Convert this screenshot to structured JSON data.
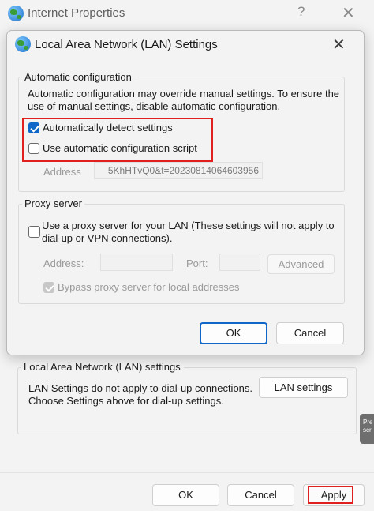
{
  "parent_window": {
    "title": "Internet Properties",
    "help_glyph": "?",
    "close_glyph": "✕",
    "lan_section": {
      "title": "Local Area Network (LAN) settings",
      "description": "LAN Settings do not apply to dial-up connections. Choose Settings above for dial-up settings.",
      "lan_settings_button": "LAN settings"
    },
    "footer": {
      "ok": "OK",
      "cancel": "Cancel",
      "apply": "Apply"
    },
    "side_tooltip": "Pre scr"
  },
  "dialog": {
    "title": "Local Area Network (LAN) Settings",
    "close_glyph": "✕",
    "automatic_configuration": {
      "group_title": "Automatic configuration",
      "description": "Automatic configuration may override manual settings.  To ensure the use of manual settings, disable automatic configuration.",
      "auto_detect": {
        "label": "Automatically detect settings",
        "checked": true
      },
      "use_script": {
        "label": "Use automatic configuration script",
        "checked": false
      },
      "address_label": "Address",
      "address_value": "5KhHTvQ0&t=20230814064603956"
    },
    "proxy_server": {
      "group_title": "Proxy server",
      "use_proxy": {
        "label": "Use a proxy server for your LAN (These settings will not apply to dial-up or VPN connections).",
        "checked": false
      },
      "address_label": "Address:",
      "address_value": "",
      "port_label": "Port:",
      "port_value": "",
      "advanced_button": "Advanced",
      "bypass_local": {
        "label": "Bypass proxy server for local addresses",
        "checked": true,
        "disabled": true
      }
    },
    "ok_button": "OK",
    "cancel_button": "Cancel"
  },
  "colors": {
    "accent": "#0f67c8",
    "highlight": "#e0201e",
    "background": "#f3f3f3"
  }
}
